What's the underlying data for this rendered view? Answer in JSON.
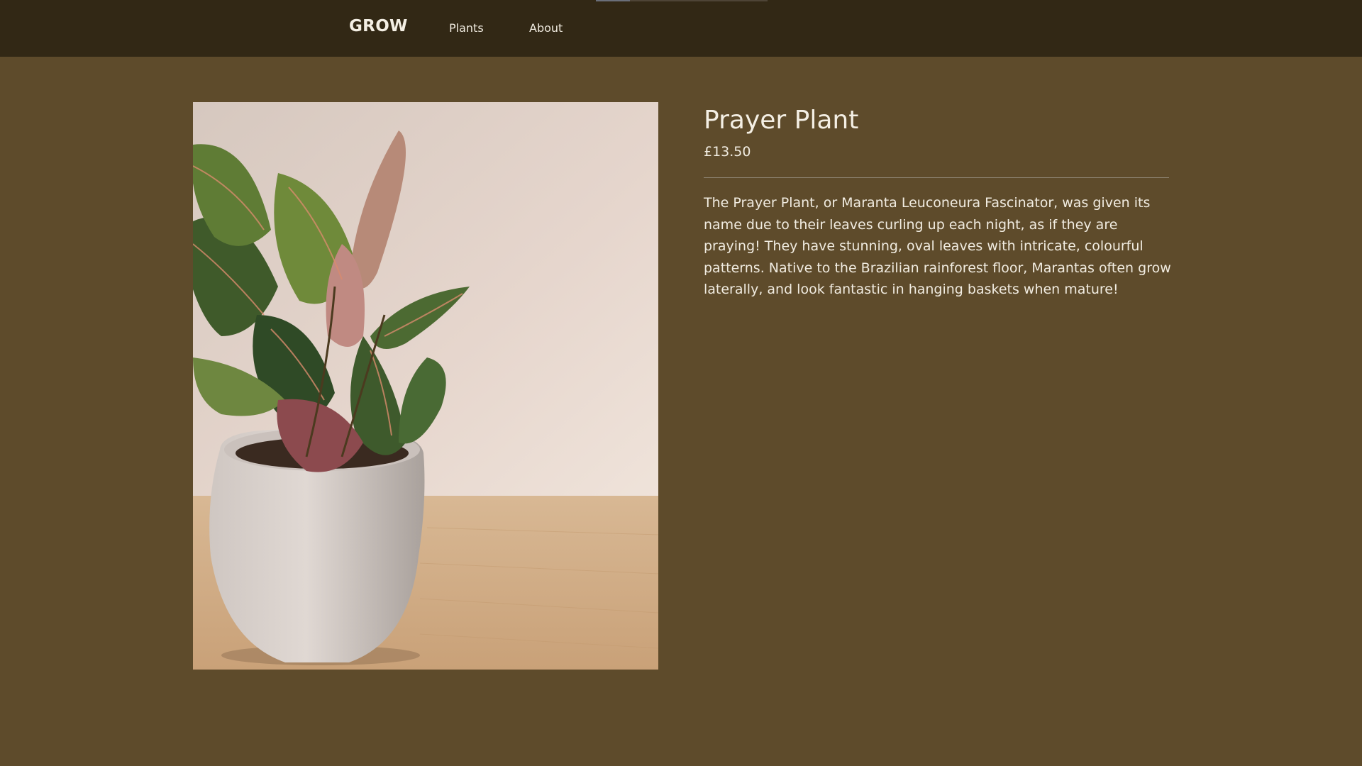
{
  "nav": {
    "brand": "GROW",
    "links": [
      {
        "label": "Plants"
      },
      {
        "label": "About"
      }
    ]
  },
  "product": {
    "title": "Prayer Plant",
    "price": "£13.50",
    "description": "The Prayer Plant, or Maranta Leuconeura Fascinator, was given its name due to their leaves curling up each night, as if they are praying! They have stunning, oval leaves with intricate, colourful patterns. Native to the Brazilian rainforest floor, Marantas often grow laterally, and look fantastic in hanging baskets when mature!",
    "image_icon": "prayer-plant-photo"
  },
  "colors": {
    "page_background": "#5e4b2b",
    "navbar_background": "#322815",
    "text": "#f4efe4",
    "divider": "#8f8573"
  }
}
